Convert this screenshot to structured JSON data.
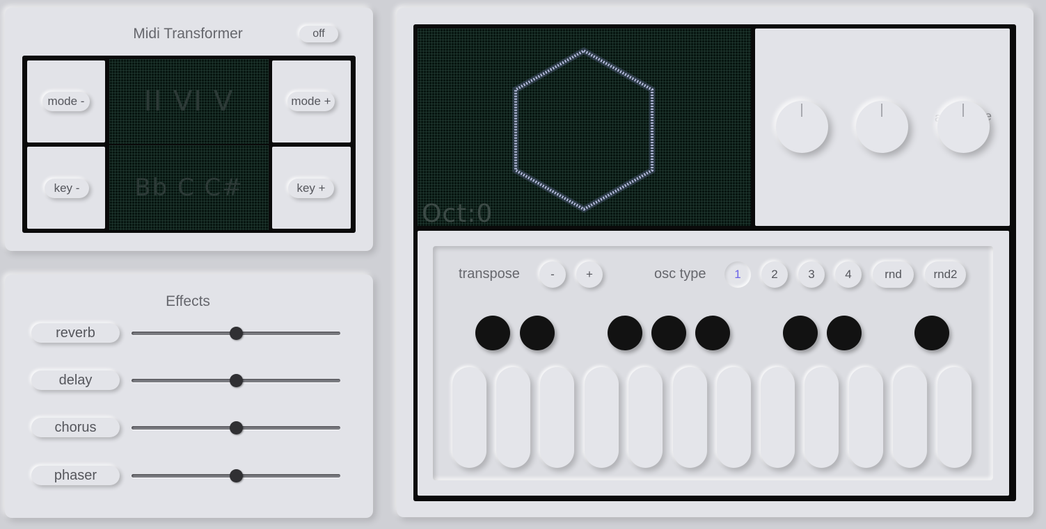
{
  "midi": {
    "title": "Midi Transformer",
    "toggle_label": "off",
    "mode_minus": "mode -",
    "mode_plus": "mode +",
    "key_minus": "key -",
    "key_plus": "key +",
    "display_mode": "II  VI  V",
    "display_key": "Bb  C  C#"
  },
  "effects": {
    "title": "Effects",
    "items": [
      {
        "label": "reverb",
        "value": 0.5
      },
      {
        "label": "delay",
        "value": 0.5
      },
      {
        "label": "chorus",
        "value": 0.5
      },
      {
        "label": "phaser",
        "value": 0.5
      }
    ]
  },
  "synth": {
    "octave_display": "Oct:0",
    "knob_label_partial_left": "a",
    "knob_label_partial_right": "e",
    "transpose_label": "transpose",
    "transpose_minus": "-",
    "transpose_plus": "+",
    "osc_type_label": "osc type",
    "osc_options": [
      "1",
      "2",
      "3",
      "4",
      "rnd",
      "rnd2"
    ],
    "osc_selected": "1",
    "accent_color": "#6b63e8",
    "black_key_count": 8,
    "white_key_count": 12
  }
}
